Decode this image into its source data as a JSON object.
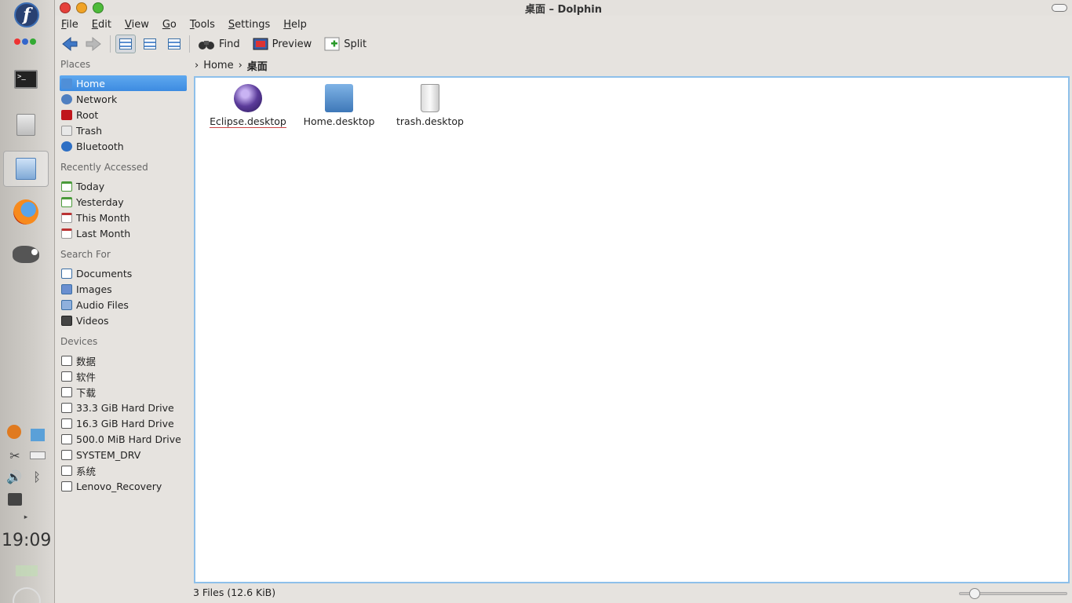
{
  "window": {
    "title": "桌面 – Dolphin"
  },
  "menu": [
    "File",
    "Edit",
    "View",
    "Go",
    "Tools",
    "Settings",
    "Help"
  ],
  "toolbar": {
    "find": "Find",
    "preview": "Preview",
    "split": "Split"
  },
  "sidebar": {
    "places_heading": "Places",
    "places": [
      "Home",
      "Network",
      "Root",
      "Trash",
      "Bluetooth"
    ],
    "recent_heading": "Recently Accessed",
    "recent": [
      "Today",
      "Yesterday",
      "This Month",
      "Last Month"
    ],
    "search_heading": "Search For",
    "search": [
      "Documents",
      "Images",
      "Audio Files",
      "Videos"
    ],
    "devices_heading": "Devices",
    "devices": [
      "数据",
      "软件",
      "下载",
      "33.3 GiB Hard Drive",
      "16.3 GiB Hard Drive",
      "500.0 MiB Hard Drive",
      "SYSTEM_DRV",
      "系统",
      "Lenovo_Recovery"
    ]
  },
  "breadcrumb": {
    "home": "Home",
    "current": "桌面"
  },
  "files": [
    "Eclipse.desktop",
    "Home.desktop",
    "trash.desktop"
  ],
  "status": {
    "text": "3 Files (12.6 KiB)"
  },
  "zoom_level": 0.1,
  "panel": {
    "clock": "19:09"
  },
  "icons": [
    "fedora-icon",
    "terminal-icon",
    "file-cabinet-icon",
    "file-manager-icon",
    "firefox-icon",
    "gimp-icon",
    "scissors-icon",
    "volume-icon",
    "bluetooth-icon",
    "printer-icon"
  ],
  "colors": {
    "selection": "#3d8be1",
    "view_border": "#8ec0ea"
  }
}
